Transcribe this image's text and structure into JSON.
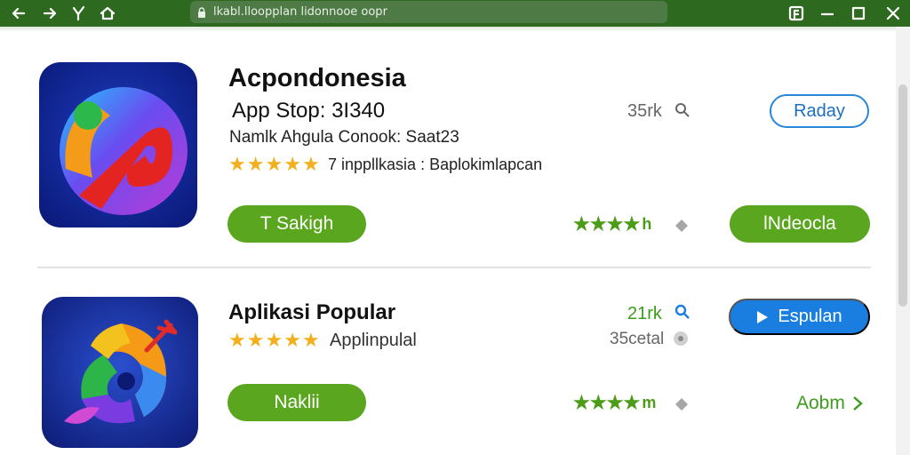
{
  "window": {
    "url": "lkabl.lloopplan lidonnooe oopr"
  },
  "apps": [
    {
      "name": "Acpondonesia",
      "subtitle": "App Stop: 3I340",
      "developer": "Namlk Ahgula Conook: Saat23",
      "rating_text": "7 inppllkasia : Baplokimlapcan",
      "stat": "35rk",
      "action_label": "Raday",
      "primary_label": "T Sakigh",
      "secondary_rating_text": "h",
      "secondary_label": "lNdeocla",
      "rating_stars": 5,
      "secondary_stars": 4
    },
    {
      "name": "Aplikasi Popular",
      "rating_text": "Applinpulal",
      "stat": "21rk",
      "stat2": "35cetal",
      "action_label": "Espulan",
      "primary_label": "Naklii",
      "secondary_rating_text": "m",
      "secondary_label": "Aobm",
      "rating_stars": 5,
      "secondary_stars": 4
    }
  ],
  "colors": {
    "titlebar": "#2d6a1f",
    "green_button": "#5aa61e",
    "blue_button": "#1a7ee0",
    "star_gold": "#f2b01e",
    "star_green": "#4c9c1a"
  }
}
